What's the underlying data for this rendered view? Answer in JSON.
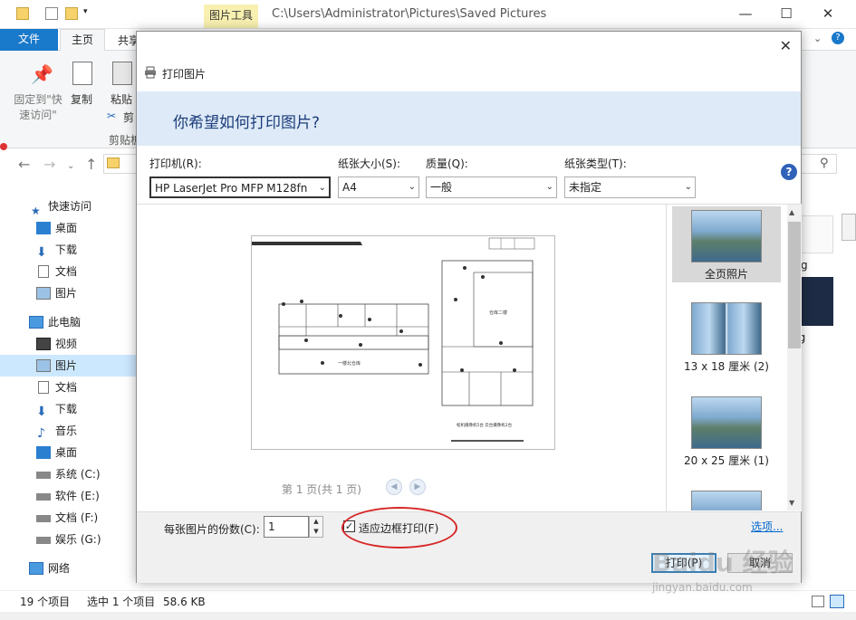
{
  "explorer": {
    "title_tools": "图片工具",
    "title_path": "C:\\Users\\Administrator\\Pictures\\Saved Pictures",
    "tabs": {
      "file": "文件",
      "home": "主页",
      "share": "共享"
    },
    "ribbon": {
      "pin": "固定到\"快\n速访问\"",
      "copy": "复制",
      "paste": "粘贴",
      "cut": "剪",
      "clipboard": "剪贴板"
    },
    "nav": [
      {
        "label": "快速访问",
        "icon": "star-icon"
      },
      {
        "label": "桌面",
        "icon": "desktop-icon"
      },
      {
        "label": "下载",
        "icon": "download-icon"
      },
      {
        "label": "文档",
        "icon": "document-icon"
      },
      {
        "label": "图片",
        "icon": "pictures-icon"
      },
      {
        "label": "此电脑",
        "icon": "computer-icon"
      },
      {
        "label": "视频",
        "icon": "video-icon"
      },
      {
        "label": "图片",
        "icon": "pictures-icon"
      },
      {
        "label": "文档",
        "icon": "document-icon"
      },
      {
        "label": "下载",
        "icon": "download-icon"
      },
      {
        "label": "音乐",
        "icon": "music-icon"
      },
      {
        "label": "桌面",
        "icon": "desktop-icon"
      },
      {
        "label": "系统 (C:)",
        "icon": "drive-icon"
      },
      {
        "label": "软件 (E:)",
        "icon": "drive-icon"
      },
      {
        "label": "文档 (F:)",
        "icon": "drive-icon"
      },
      {
        "label": "娱乐 (G:)",
        "icon": "drive-icon"
      },
      {
        "label": "网络",
        "icon": "network-icon"
      }
    ],
    "right_labels": [
      "g",
      "ng"
    ],
    "status": {
      "count": "19 个项目",
      "selected": "选中 1 个项目",
      "size": "58.6 KB"
    }
  },
  "dialog": {
    "title": "打印图片",
    "question": "你希望如何打印图片?",
    "printer_label": "打印机(R):",
    "printer_value": "HP LaserJet Pro MFP M128fn",
    "paper_size_label": "纸张大小(S):",
    "paper_size_value": "A4",
    "quality_label": "质量(Q):",
    "quality_value": "一般",
    "paper_type_label": "纸张类型(T):",
    "paper_type_value": "未指定",
    "page_indicator": "第 1 页(共 1 页)",
    "layouts": [
      {
        "label": "全页照片"
      },
      {
        "label": "13 x 18 厘米 (2)"
      },
      {
        "label": "20 x 25 厘米 (1)"
      }
    ],
    "copies_label": "每张图片的份数(C):",
    "copies_value": "1",
    "fit_label": "适应边框打印(F)",
    "options_link": "选项...",
    "print_button": "打印(P)",
    "cancel_button": "取消",
    "preview_texts": {
      "left_room": "一楼北仓库",
      "right_room": "仓库二楼",
      "note": "松机摄像机5台 云台摄像机2台"
    }
  },
  "watermark": {
    "main": "Baidu 经验",
    "sub": "jingyan.baidu.com"
  },
  "colors": {
    "accent": "#1979ca",
    "header": "#deeaf7",
    "highlight": "#d72828"
  }
}
